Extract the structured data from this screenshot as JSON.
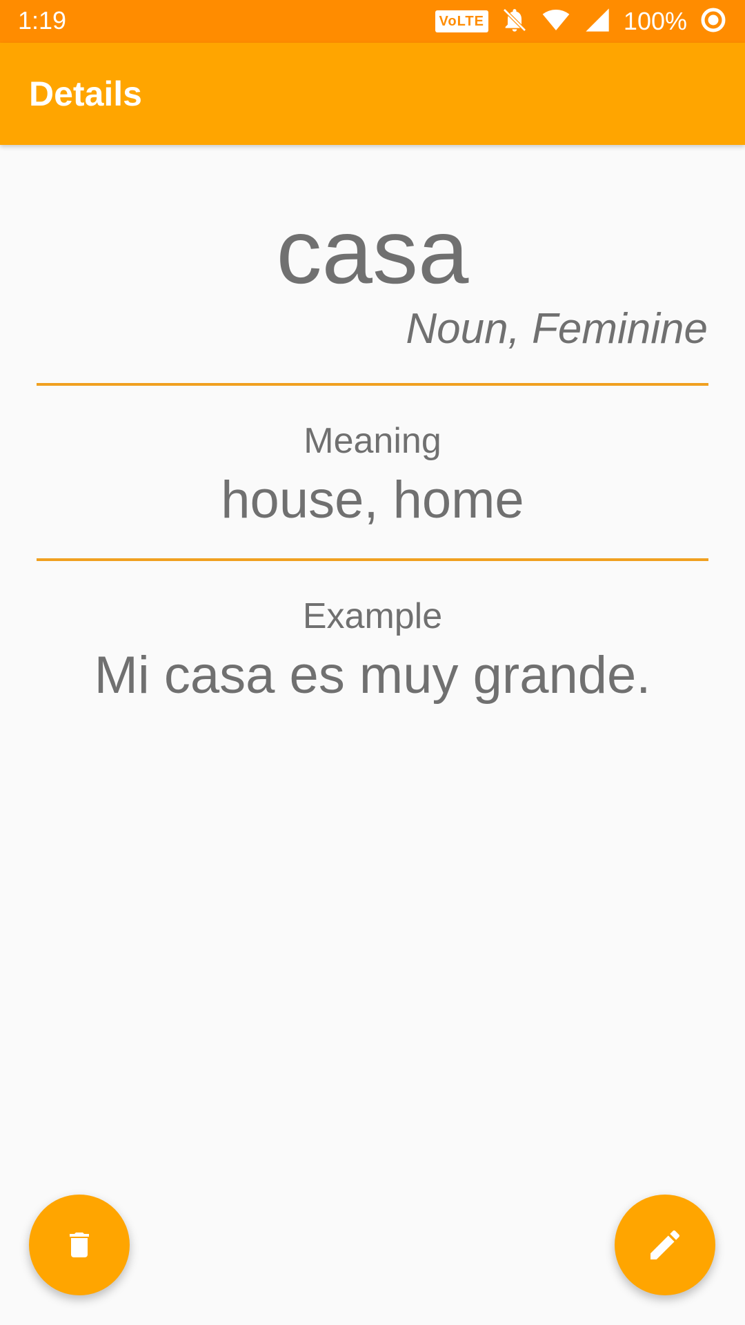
{
  "status_bar": {
    "time": "1:19",
    "volte_label": "VoLTE",
    "battery_percent": "100%"
  },
  "app_bar": {
    "title": "Details"
  },
  "word": {
    "text": "casa",
    "type": "Noun, Feminine"
  },
  "meaning": {
    "label": "Meaning",
    "value": "house, home"
  },
  "example": {
    "label": "Example",
    "value": "Mi casa es muy grande."
  },
  "fabs": {
    "delete_icon": "trash-icon",
    "edit_icon": "pencil-icon"
  },
  "colors": {
    "status_bar": "#ff8c00",
    "app_bar": "#ffa500",
    "accent": "#f0a020",
    "text": "#707070",
    "background": "#fafafa"
  }
}
